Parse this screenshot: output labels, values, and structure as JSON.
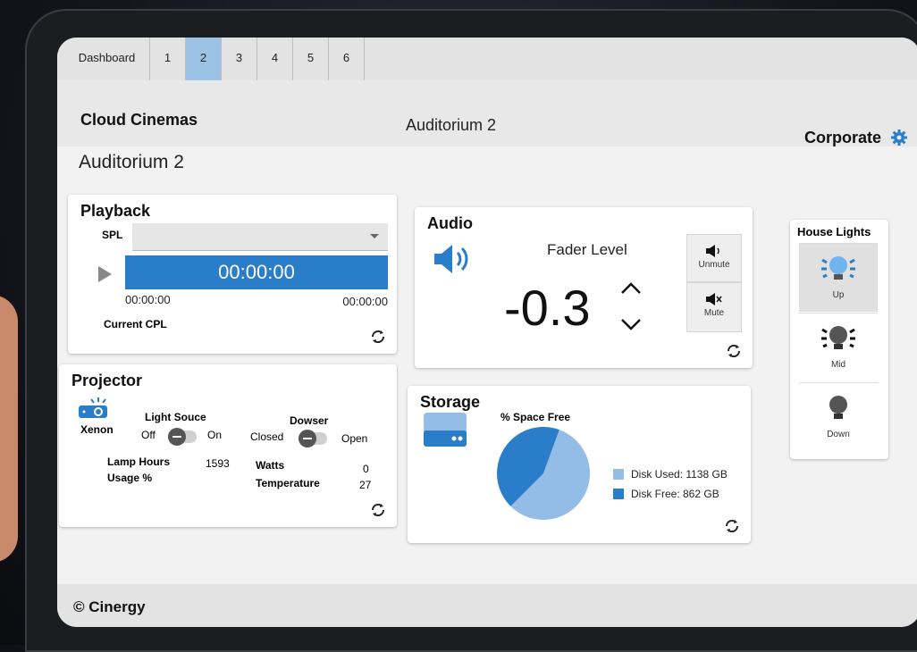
{
  "tabs": [
    "Dashboard",
    "1",
    "2",
    "3",
    "4",
    "5",
    "6"
  ],
  "header": {
    "brand": "Cloud Cinemas",
    "title": "Auditorium 2",
    "account": "Corporate"
  },
  "page_title": "Auditorium 2",
  "playback": {
    "title": "Playback",
    "spl_label": "SPL",
    "progress_time": "00:00:00",
    "elapsed": "00:00:00",
    "remaining": "00:00:00",
    "current_cpl_label": "Current CPL"
  },
  "projector": {
    "title": "Projector",
    "lamp_type": "Xenon",
    "light_source_label": "Light Souce",
    "off": "Off",
    "on": "On",
    "dowser_label": "Dowser",
    "closed": "Closed",
    "open": "Open",
    "lamp_hours_label": "Lamp Hours",
    "usage_label": "Usage %",
    "lamp_hours_value": "1593",
    "watts_label": "Watts",
    "watts_value": "0",
    "temperature_label": "Temperature",
    "temperature_value": "27"
  },
  "audio": {
    "title": "Audio",
    "fader_label": "Fader Level",
    "fader_value": "-0.3",
    "unmute": "Unmute",
    "mute": "Mute"
  },
  "storage": {
    "title": "Storage",
    "chart_label": "% Space Free",
    "used_label": "Disk Used: 1138 GB",
    "free_label": "Disk Free: 862 GB",
    "colors": {
      "used": "#93bde6",
      "free": "#2a7dc9"
    }
  },
  "chart_data": {
    "type": "pie",
    "title": "% Space Free",
    "categories": [
      "Disk Used",
      "Disk Free"
    ],
    "values": [
      1138,
      862
    ]
  },
  "house_lights": {
    "title": "House Lights",
    "up": "Up",
    "mid": "Mid",
    "down": "Down"
  },
  "footer": {
    "copyright": "© Cinergy"
  }
}
